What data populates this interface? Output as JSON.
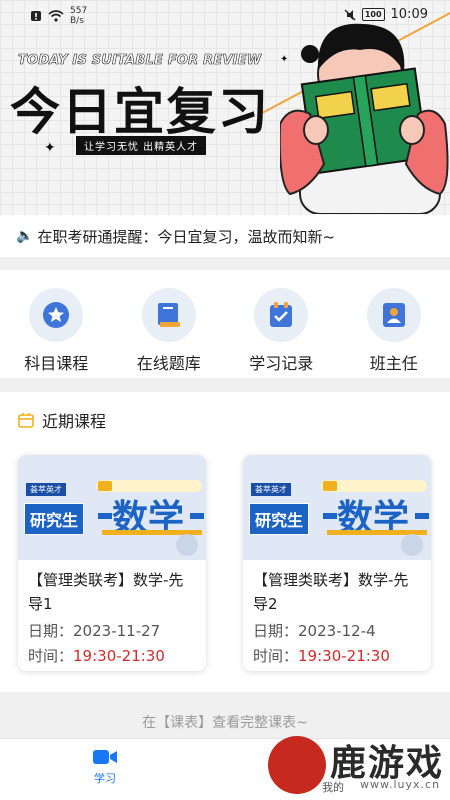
{
  "status_bar": {
    "speed_value": "557",
    "speed_unit": "B/s",
    "battery": "100",
    "time": "10:09"
  },
  "banner": {
    "subtitle_en": "TODAY IS SUITABLE FOR REVIEW",
    "title": "今日宜复习",
    "tagline": "让学习无忧  出精英人才"
  },
  "notice": {
    "text": "在职考研通提醒：今日宜复习，温故而知新~"
  },
  "quick_menu": [
    {
      "label": "科目课程",
      "icon": "badge-icon"
    },
    {
      "label": "在线题库",
      "icon": "book-icon"
    },
    {
      "label": "学习记录",
      "icon": "clipboard-check-icon"
    },
    {
      "label": "班主任",
      "icon": "id-card-icon"
    }
  ],
  "courses_section": {
    "title": "近期课程",
    "date_label": "日期：",
    "time_label": "时间：",
    "thumb": {
      "brand": "荟萃英才",
      "badge": "研究生",
      "subject": "数学"
    },
    "items": [
      {
        "title": "【管理类联考】数学-先导1",
        "date": "2023-11-27",
        "time": "19:30-21:30"
      },
      {
        "title": "【管理类联考】数学-先导2",
        "date": "2023-12-4",
        "time": "19:30-21:30"
      }
    ]
  },
  "footer_hint": "在【课表】查看完整课表~",
  "tab_bar": [
    {
      "label": "学习",
      "icon": "video-icon",
      "active": true
    },
    {
      "label": "我的",
      "icon": "user-icon",
      "active": false
    }
  ],
  "watermark": {
    "text": "鹿游戏",
    "url": "www.luyx.cn"
  },
  "colors": {
    "accent": "#1877f2",
    "time_red": "#d62a2a",
    "orange": "#f2a33a"
  }
}
